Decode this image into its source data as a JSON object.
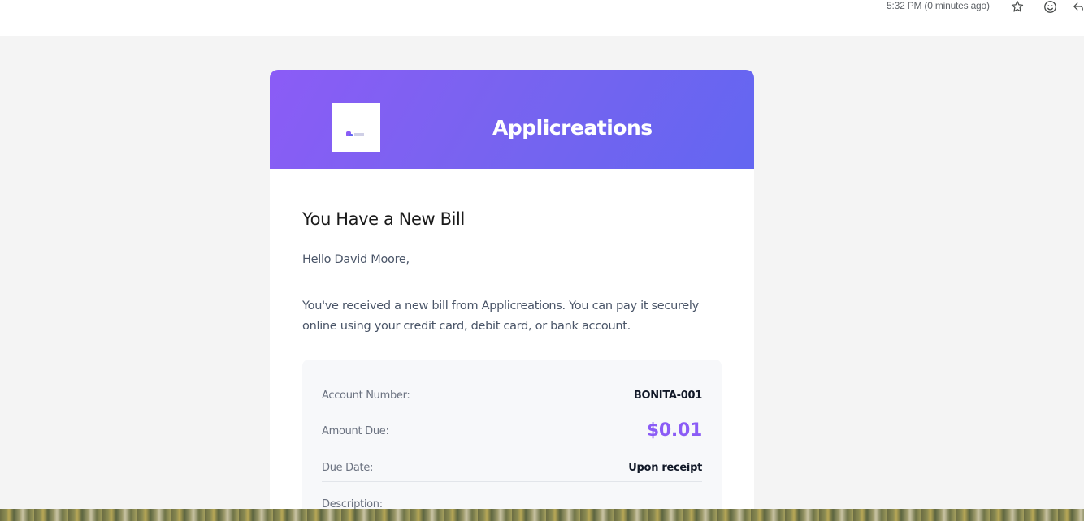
{
  "email_header": {
    "timestamp": "5:32 PM (0 minutes ago)",
    "icons": [
      "star-icon",
      "emoji-icon",
      "reply-icon"
    ]
  },
  "colors": {
    "header_gradient_start": "#8b5cf6",
    "header_gradient_end": "#6366f1",
    "amount_color": "#8b5cf6",
    "page_background": "#f4f4f4"
  },
  "email_body": {
    "brand_name": "Applicreations",
    "title": "You Have a New Bill",
    "greeting": "Hello David Moore,",
    "message": "You've received a new bill from Applicreations. You can pay it securely online using your credit card, debit card, or bank account.",
    "details": {
      "account_number_label": "Account Number:",
      "account_number_value": "BONITA-001",
      "amount_due_label": "Amount Due:",
      "amount_due_value": "$0.01",
      "due_date_label": "Due Date:",
      "due_date_value": "Upon receipt",
      "description_label": "Description:"
    }
  }
}
